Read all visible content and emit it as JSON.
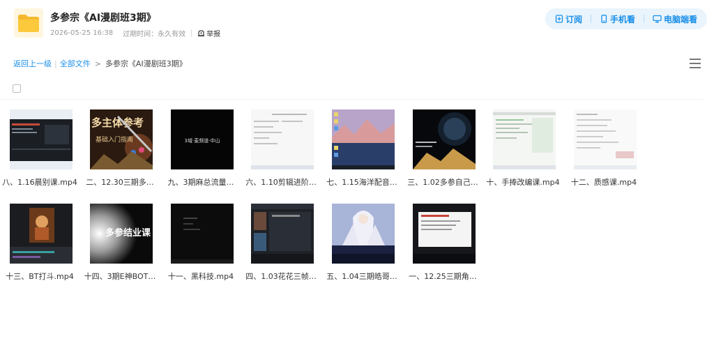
{
  "header": {
    "title": "多参宗《AI漫剧班3期》",
    "date": "2026-05-25 16:38",
    "expire_label": "过期时间：永久有效",
    "report_label": "举报",
    "actions": [
      {
        "label": "订阅",
        "icon": "subscribe-icon"
      },
      {
        "label": "手机看",
        "icon": "phone-icon"
      },
      {
        "label": "电脑端看",
        "icon": "computer-icon"
      }
    ]
  },
  "breadcrumb": {
    "back": "返回上一级",
    "all_files": "全部文件",
    "current": "多参宗《AI漫剧班3期》"
  },
  "files": [
    {
      "name": "八、1.16晨别课.mp4",
      "thumb": "tech"
    },
    {
      "name": "二、12.30三期多…",
      "thumb": "title"
    },
    {
      "name": "九、3期麻总流量…",
      "thumb": "black"
    },
    {
      "name": "六、1.10剪辑进阶…",
      "thumb": "doc"
    },
    {
      "name": "七、1.15海洋配音…",
      "thumb": "desktop"
    },
    {
      "name": "三、1.02多参自己…",
      "thumb": "space"
    },
    {
      "name": "十、手捧改编课.mp4",
      "thumb": "sheet"
    },
    {
      "name": "十二、质感课.mp4",
      "thumb": "sheet2"
    },
    {
      "name": "十三、BT打斗.mp4",
      "thumb": "editor"
    },
    {
      "name": "十四、3期E神BOT…",
      "thumb": "glow"
    },
    {
      "name": "十一、黑科技.mp4",
      "thumb": "dark"
    },
    {
      "name": "四、1.03花花三帧…",
      "thumb": "app"
    },
    {
      "name": "五、1.04三期皓哥…",
      "thumb": "anime"
    },
    {
      "name": "一、12.25三期角…",
      "thumb": "slide"
    }
  ],
  "thumb_text": {
    "title_big": "多主体参考",
    "title_small": "基础入门指南",
    "black": "3域·麦频道·中山",
    "glow": "多参结业课"
  },
  "colors": {
    "accent": "#1a8fe8",
    "folder": "#f5b82e"
  }
}
